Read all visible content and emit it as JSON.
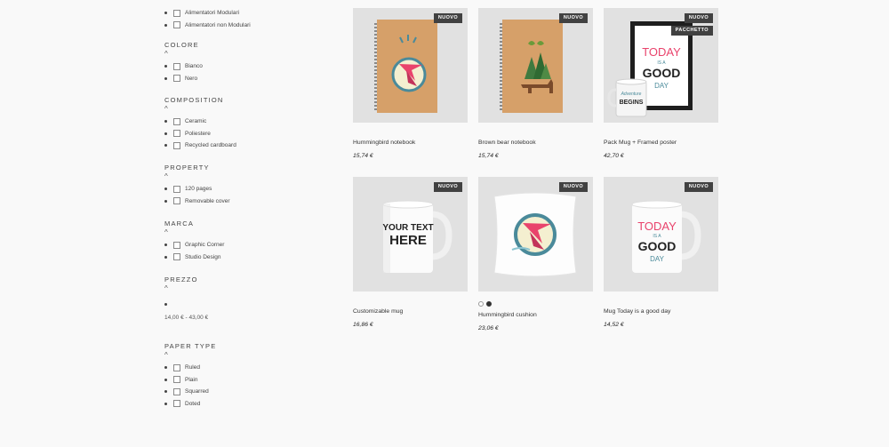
{
  "facets": {
    "alimentatori": {
      "items": [
        "Alimentatori Modulari",
        "Alimentatori non Modulari"
      ]
    },
    "colore": {
      "title": "COLORE",
      "caret": "^",
      "items": [
        "Bianco",
        "Nero"
      ]
    },
    "composition": {
      "title": "COMPOSITION",
      "caret": "^",
      "items": [
        "Ceramic",
        "Poliestere",
        "Recycled cardboard"
      ]
    },
    "property": {
      "title": "PROPERTY",
      "caret": "^",
      "items": [
        "120 pages",
        "Removable cover"
      ]
    },
    "marca": {
      "title": "MARCA",
      "caret": "^",
      "items": [
        "Graphic Corner",
        "Studio Design"
      ]
    },
    "prezzo": {
      "title": "PREZZO",
      "caret": "^",
      "range": "14,00 € - 43,00 €"
    },
    "paper_type": {
      "title": "PAPER TYPE",
      "caret": "^",
      "items": [
        "Ruled",
        "Plain",
        "Squarred",
        "Doted"
      ]
    }
  },
  "products": [
    {
      "name": "Hummingbird notebook",
      "price": "15,74 €",
      "flags": [
        "NUOVO"
      ],
      "image": "notebook-hummingbird"
    },
    {
      "name": "Brown bear notebook",
      "price": "15,74 €",
      "flags": [
        "NUOVO"
      ],
      "image": "notebook-bear"
    },
    {
      "name": "Pack Mug + Framed poster",
      "price": "42,70 €",
      "flags": [
        "NUOVO",
        "PACCHETTO"
      ],
      "image": "poster-mug",
      "artwork": {
        "line1": "TODAY",
        "line2": "IS A",
        "line3": "GOOD",
        "line4": "DAY",
        "mug_line1": "Adventure",
        "mug_line2": "BEGINS"
      }
    },
    {
      "name": "Customizable mug",
      "price": "16,86 €",
      "flags": [
        "NUOVO"
      ],
      "image": "mug-custom",
      "artwork": {
        "line1": "YOUR TEXT",
        "line2": "HERE"
      }
    },
    {
      "name": "Hummingbird cushion",
      "price": "23,06 €",
      "flags": [
        "NUOVO"
      ],
      "image": "cushion",
      "carousel_active": 2
    },
    {
      "name": "Mug Today is a good day",
      "price": "14,52 €",
      "flags": [
        "NUOVO"
      ],
      "image": "mug-today",
      "artwork": {
        "line1": "TODAY",
        "line2": "IS A",
        "line3": "GOOD",
        "line4": "DAY"
      }
    }
  ],
  "colors": {
    "flag_bg": "#414141",
    "thumb_bg": "#e1e1e1",
    "page_bg": "#f9f9f9",
    "kraft": "#d6a069",
    "pink": "#e9436c",
    "teal": "#4a8a9a"
  }
}
